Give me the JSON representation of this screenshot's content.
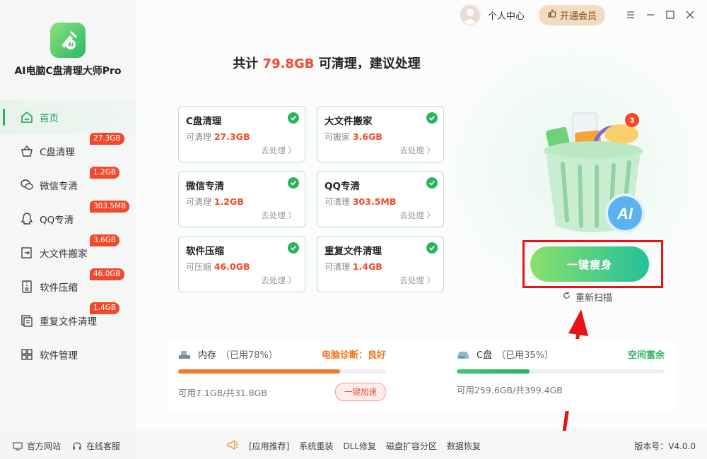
{
  "app": {
    "name": "AI电脑C盘清理大师Pro"
  },
  "sidebar": {
    "items": [
      {
        "label": "首页",
        "badge": ""
      },
      {
        "label": "C盘清理",
        "badge": "27.3GB"
      },
      {
        "label": "微信专清",
        "badge": "1.2GB"
      },
      {
        "label": "QQ专清",
        "badge": "303.5MB"
      },
      {
        "label": "大文件搬家",
        "badge": "3.6GB"
      },
      {
        "label": "软件压缩",
        "badge": "46.0GB"
      },
      {
        "label": "重复文件清理",
        "badge": "1.4GB"
      },
      {
        "label": "软件管理",
        "badge": ""
      }
    ],
    "footer": {
      "site": "官方网站",
      "service": "在线客服"
    }
  },
  "topbar": {
    "user_center": "个人中心",
    "vip": "开通会员"
  },
  "headline": {
    "prefix": "共计 ",
    "amount": "79.8GB",
    "suffix": " 可清理，建议处理"
  },
  "cards": [
    {
      "title": "C盘清理",
      "label": "可清理",
      "value": "27.3GB",
      "action": "去处理 〉"
    },
    {
      "title": "大文件搬家",
      "label": "可搬家",
      "value": "3.6GB",
      "action": "去处理 〉"
    },
    {
      "title": "微信专清",
      "label": "可清理",
      "value": "1.2GB",
      "action": "去处理 〉"
    },
    {
      "title": "QQ专清",
      "label": "可清理",
      "value": "303.5MB",
      "action": "去处理 〉"
    },
    {
      "title": "软件压缩",
      "label": "可压缩",
      "value": "46.0GB",
      "action": "去处理 〉"
    },
    {
      "title": "重复文件清理",
      "label": "可清理",
      "value": "1.4GB",
      "action": "去处理 〉"
    }
  ],
  "cta": {
    "label": "一键瘦身",
    "rescan": "重新扫描"
  },
  "trash_badge": "3",
  "trash_ai": "AI",
  "memory": {
    "title": "内存",
    "used_pct": "（已用78%）",
    "fill": 0.78,
    "status": "电脑诊断：良好",
    "status_color": "#f0741e",
    "detail": "可用7.1GB/共31.8GB",
    "boost": "一键加速"
  },
  "disk": {
    "title": "C盘",
    "used_pct": "（已用35%）",
    "fill": 0.35,
    "status": "空间富余",
    "status_color": "#2bb45f",
    "detail": "可用259.6GB/共399.4GB"
  },
  "footer": {
    "links": [
      "[应用推荐]",
      "系统重装",
      "DLL修复",
      "磁盘扩容分区",
      "数据恢复"
    ],
    "version": "版本号：V4.0.0"
  },
  "colors": {
    "accent": "#27b25d",
    "alert": "#f04a2c"
  }
}
